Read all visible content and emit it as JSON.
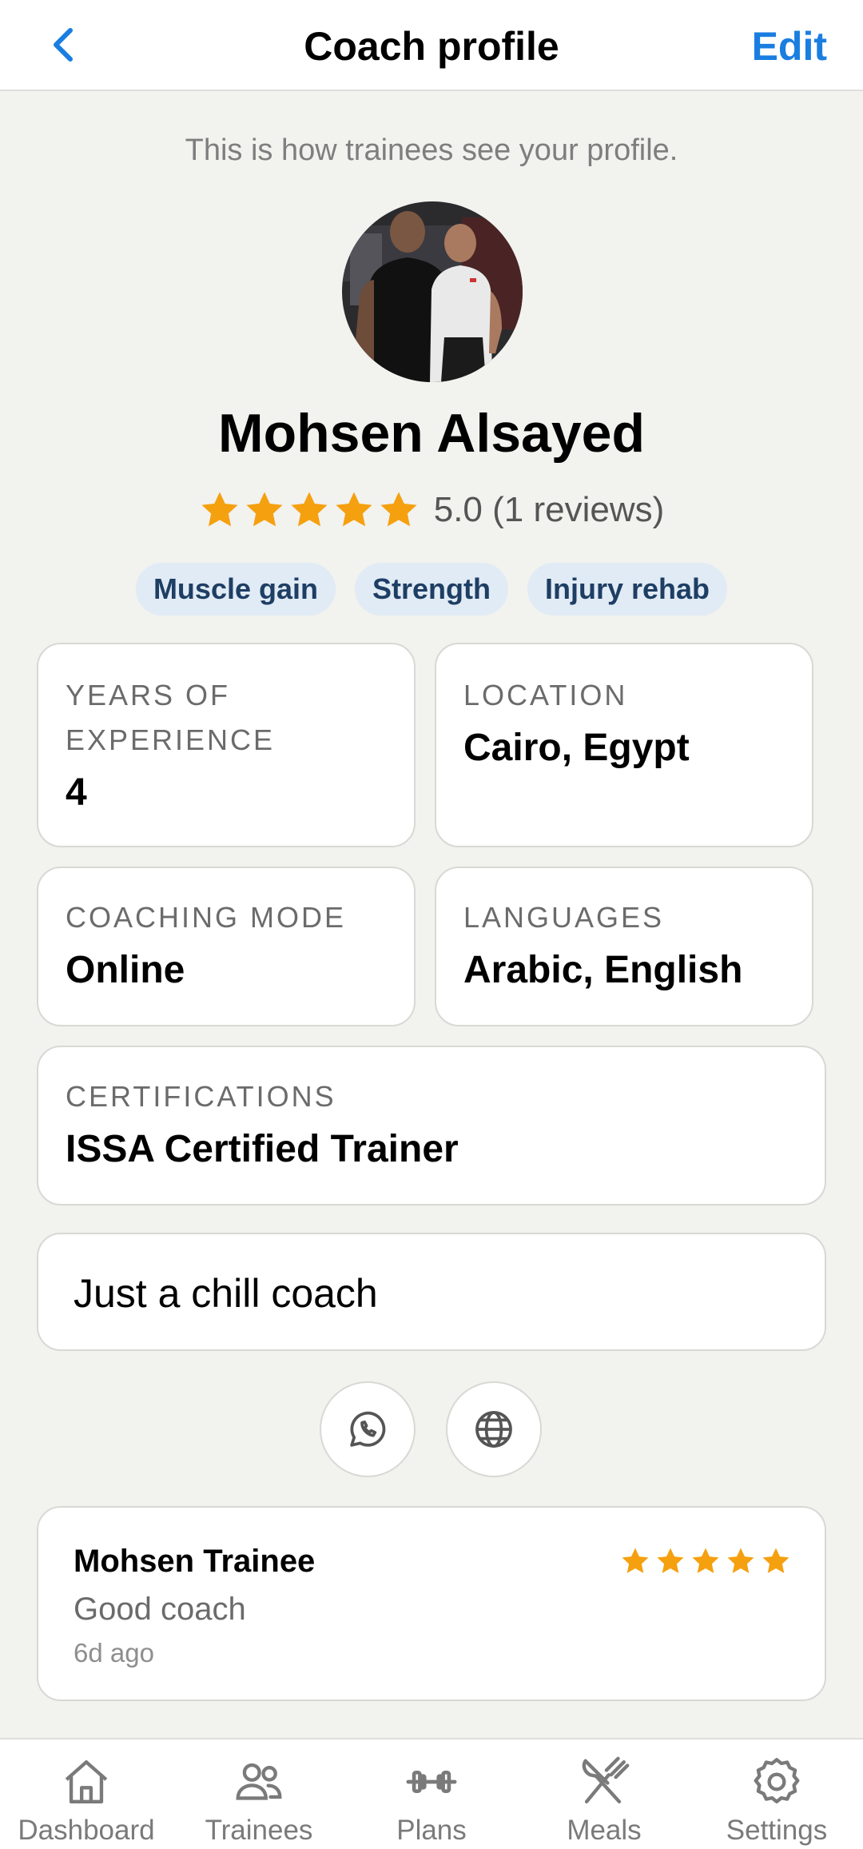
{
  "header": {
    "title": "Coach profile",
    "edit_label": "Edit"
  },
  "hint": "This is how trainees see your profile.",
  "coach": {
    "name": "Mohsen Alsayed",
    "rating": 5,
    "rating_text": "5.0 (1 reviews)",
    "tags": [
      "Muscle gain",
      "Strength",
      "Injury rehab"
    ]
  },
  "info": {
    "experience": {
      "label": "Years of experience",
      "value": "4"
    },
    "location": {
      "label": "Location",
      "value": "Cairo, Egypt"
    },
    "mode": {
      "label": "Coaching mode",
      "value": "Online"
    },
    "languages": {
      "label": "Languages",
      "value": "Arabic, English"
    },
    "certifications": {
      "label": "Certifications",
      "value": "ISSA Certified Trainer"
    }
  },
  "bio": "Just a chill coach",
  "contact": {
    "whatsapp_icon": "whatsapp-icon",
    "website_icon": "globe-icon"
  },
  "reviews": [
    {
      "name": "Mohsen Trainee",
      "stars": 5,
      "comment": "Good coach",
      "time": "6d ago"
    }
  ],
  "tabs": [
    {
      "label": "Dashboard",
      "icon": "home-icon"
    },
    {
      "label": "Trainees",
      "icon": "people-icon"
    },
    {
      "label": "Plans",
      "icon": "dumbbell-icon"
    },
    {
      "label": "Meals",
      "icon": "utensils-icon"
    },
    {
      "label": "Settings",
      "icon": "gear-icon"
    }
  ],
  "colors": {
    "accent": "#1a7ee0",
    "star": "#f5a00f",
    "background": "#f2f2ee",
    "tag_bg": "#e1ebf5",
    "tag_text": "#1e3e64"
  }
}
